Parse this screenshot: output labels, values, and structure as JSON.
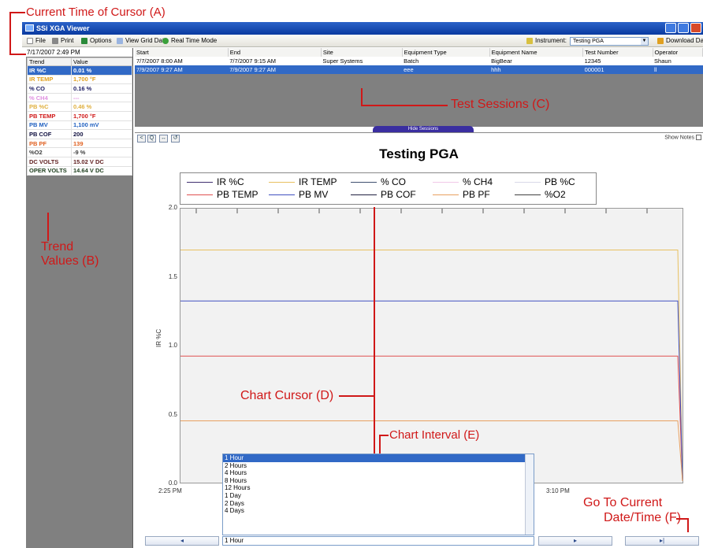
{
  "callouts": {
    "a": "Current Time of Cursor (A)",
    "b1": "Trend",
    "b2": "Values (B)",
    "c": "Test Sessions  (C)",
    "d": "Chart Cursor (D)",
    "e": "Chart Interval (E)",
    "f1": "Go To Current",
    "f2": "Date/Time (F)"
  },
  "window": {
    "title": "SSi XGA Viewer"
  },
  "toolbar": {
    "file": "File",
    "print": "Print",
    "options": "Options",
    "view_grid": "View Grid Data",
    "realtime": "Real Time Mode",
    "instrument_label": "Instrument:",
    "instrument_value": "Testing PGA",
    "download": "Download Dat"
  },
  "left_panel": {
    "cursor_time": "7/17/2007 2:49 PM",
    "headers": [
      "Trend",
      "Value"
    ],
    "rows": [
      {
        "trend": "IR %C",
        "value": "0.01 %",
        "color": "#ffffff",
        "selected": true
      },
      {
        "trend": "IR TEMP",
        "value": "1,700 °F",
        "color": "#e0a020"
      },
      {
        "trend": "% CO",
        "value": "0.16 %",
        "color": "#1a1a60"
      },
      {
        "trend": "% CH4",
        "value": "---",
        "color": "#e090e0"
      },
      {
        "trend": "PB %C",
        "value": "0.46 %",
        "color": "#e0b040"
      },
      {
        "trend": "PB TEMP",
        "value": "1,700 °F",
        "color": "#d01818"
      },
      {
        "trend": "PB MV",
        "value": "1,100 mV",
        "color": "#2060c0"
      },
      {
        "trend": "PB COF",
        "value": "200",
        "color": "#101040"
      },
      {
        "trend": "PB PF",
        "value": "139",
        "color": "#e06020"
      },
      {
        "trend": "%O2",
        "value": "-9 %",
        "color": "#404040"
      },
      {
        "trend": "DC VOLTS",
        "value": "15.02 V DC",
        "color": "#602020"
      },
      {
        "trend": "OPER VOLTS",
        "value": "14.64 V DC",
        "color": "#204020"
      }
    ]
  },
  "sessions": {
    "headers": [
      "Start",
      "End",
      "Site",
      "Equipment Type",
      "Equipment Name",
      "Test Number",
      "Operator"
    ],
    "rows": [
      [
        "7/7/2007 8:00 AM",
        "7/7/2007 9:15 AM",
        "Super Systems",
        "Batch",
        "BigBear",
        "12345",
        "Shaun"
      ],
      [
        "7/9/2007 9:27 AM",
        "7/9/2007 9:27 AM",
        "",
        "eee",
        "hhh",
        "000001",
        "ll"
      ]
    ],
    "hide_label": "Hide Sessions"
  },
  "chart": {
    "show_notes": "Show Notes",
    "tools": [
      "<",
      "Q",
      "↔",
      "↺"
    ]
  },
  "interval": {
    "options": [
      "1 Hour",
      "2 Hours",
      "4 Hours",
      "8 Hours",
      "12 Hours",
      "1 Day",
      "2 Days",
      "4 Days"
    ],
    "selected": "1 Hour"
  },
  "nav": {
    "back": "◂",
    "forward": "▸",
    "now": "▸|"
  },
  "chart_data": {
    "type": "line",
    "title": "Testing PGA",
    "ylabel": "IR %C",
    "ylim": [
      0,
      2.0
    ],
    "yticks": [
      "0.0",
      "0.5",
      "1.0",
      "1.5",
      "2.0"
    ],
    "xticks": [
      "2:25 PM",
      "3:10 PM"
    ],
    "legend_placement": "top",
    "grid": false,
    "series": [
      {
        "name": "IR %C",
        "color": "#403070",
        "value": null
      },
      {
        "name": "IR TEMP",
        "color": "#e8c060",
        "value": 1.7
      },
      {
        "name": "% CO",
        "color": "#405070",
        "value": null
      },
      {
        "name": "% CH4",
        "color": "#f0c8e8",
        "value": null
      },
      {
        "name": "PB %C",
        "color": "#d8d8e8",
        "value": null
      },
      {
        "name": "PB TEMP",
        "color": "#e05050",
        "value": 0.93
      },
      {
        "name": "PB MV",
        "color": "#4050c0",
        "value": 1.33
      },
      {
        "name": "PB COF",
        "color": "#202040",
        "value": null
      },
      {
        "name": "PB PF",
        "color": "#e8a060",
        "value": 0.46
      },
      {
        "name": "%O2",
        "color": "#404040",
        "value": null
      }
    ]
  }
}
